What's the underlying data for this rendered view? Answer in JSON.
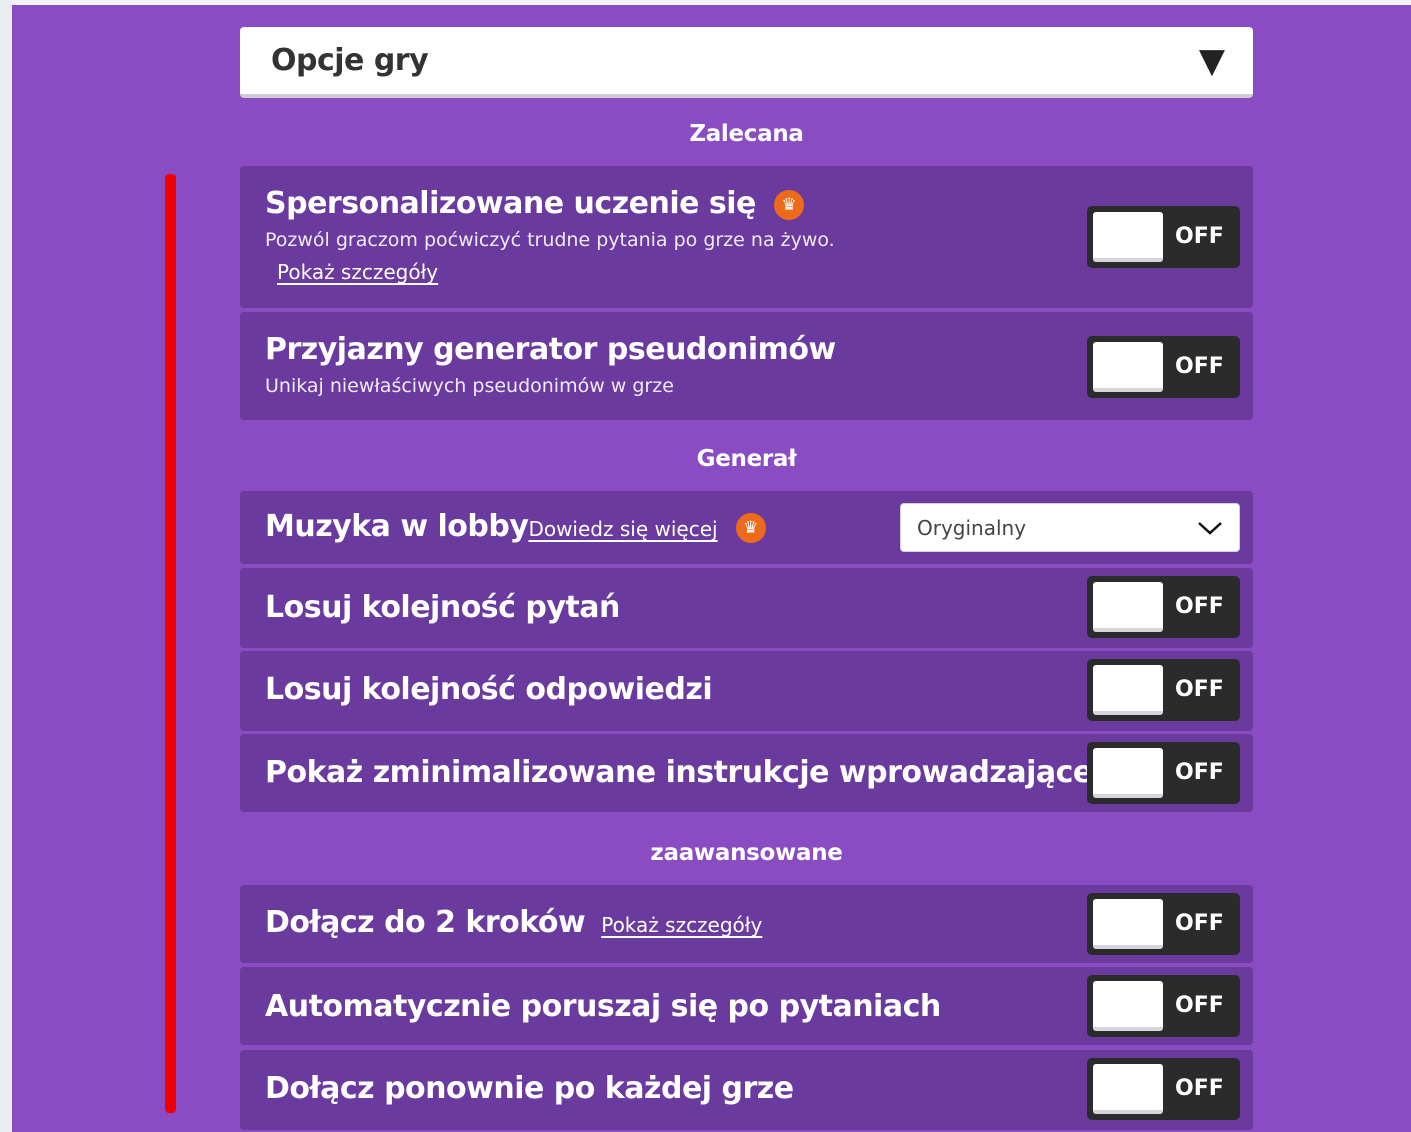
{
  "header": {
    "title": "Opcje gry",
    "chevron": "▼"
  },
  "sections": {
    "recommended": "Zalecana",
    "general": "Generał",
    "advanced": "zaawansowane"
  },
  "toggle_label": "OFF",
  "rows": {
    "personalized": {
      "title": "Spersonalizowane uczenie się",
      "subtitle": "Pozwól graczom poćwiczyć trudne pytania po grze na żywo.",
      "link": "Pokaż szczegóły",
      "state": "OFF"
    },
    "nickname": {
      "title": "Przyjazny generator pseudonimów",
      "subtitle": "Unikaj niewłaściwych pseudonimów w grze",
      "state": "OFF"
    },
    "music": {
      "title": "Muzyka w lobby",
      "link": "Dowiedz się więcej",
      "select_value": "Oryginalny"
    },
    "shuffle_questions": {
      "title": "Losuj kolejność pytań",
      "state": "OFF"
    },
    "shuffle_answers": {
      "title": "Losuj kolejność odpowiedzi",
      "state": "OFF"
    },
    "minimized_intro": {
      "title": "Pokaż zminimalizowane instrukcje wprowadzające",
      "state": "OFF"
    },
    "two_step": {
      "title": "Dołącz do 2 kroków",
      "link": "Pokaż szczegóły",
      "state": "OFF"
    },
    "auto_move": {
      "title": "Automatycznie poruszaj się po pytaniach",
      "state": "OFF"
    },
    "rejoin": {
      "title": "Dołącz ponownie po każdej grze",
      "state": "OFF"
    }
  },
  "icons": {
    "premium": "crown-icon",
    "dropdown": "chevron-down-icon"
  },
  "colors": {
    "background": "#8a4cc2",
    "row": "#6a3a9e",
    "toggle": "#2b2b2b",
    "accent_red": "#f00000",
    "crown": "#ee6a1b"
  }
}
